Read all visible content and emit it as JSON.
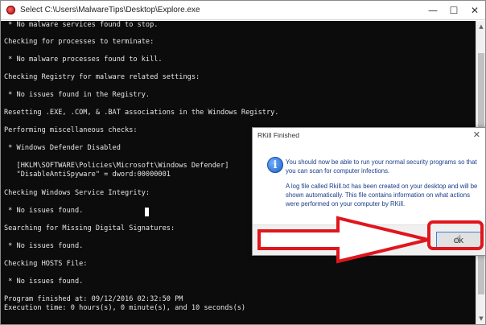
{
  "window": {
    "title": "Select C:\\Users\\MalwareTips\\Desktop\\Explore.exe",
    "controls": {
      "minimize": "—",
      "maximize": "☐",
      "close": "✕"
    }
  },
  "console": {
    "lines": [
      " * No malware services found to stop.",
      "Checking for processes to terminate:",
      " * No malware processes found to kill.",
      "Checking Registry for malware related settings:",
      " * No issues found in the Registry.",
      "Resetting .EXE, .COM, & .BAT associations in the Windows Registry.",
      "Performing miscellaneous checks:",
      " * Windows Defender Disabled",
      "   [HKLM\\SOFTWARE\\Policies\\Microsoft\\Windows Defender]",
      "   \"DisableAntiSpyware\" = dword:00000001",
      "Checking Windows Service Integrity:",
      " * No issues found.",
      "Searching for Missing Digital Signatures:",
      " * No issues found.",
      "Checking HOSTS File:",
      " * No issues found.",
      "Program finished at: 09/12/2016 02:32:50 PM",
      "Execution time: 0 hours(s), 0 minute(s), and 10 seconds(s)"
    ],
    "scroll_up": "▲",
    "scroll_down": "▼"
  },
  "dialog": {
    "title": "RKill Finished",
    "close": "✕",
    "icon_glyph": "i",
    "message_1": "You should now be able to run your normal security programs so that you can scan for computer infections.",
    "message_2": "A log file called Rkill.txt has been created on your desktop and will be shown automatically.  This file contains information on what actions were performed on your computer by RKill.",
    "ok_label": "OK"
  },
  "colors": {
    "console_bg": "#0c0c0c",
    "console_text": "#e6e6e6",
    "dialog_text": "#1a3d8c",
    "annotation": "#e0161d"
  }
}
